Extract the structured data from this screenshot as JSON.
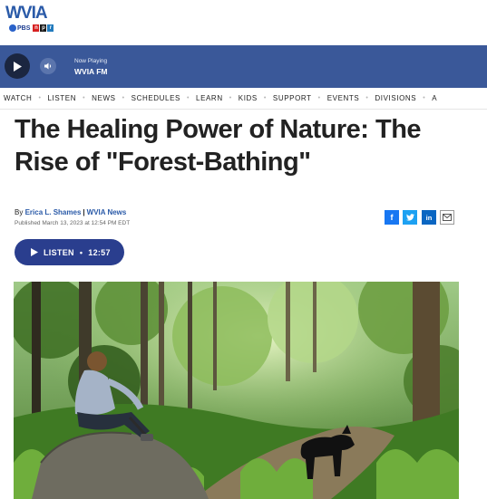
{
  "brand": {
    "logo_main": "WVIA",
    "logo_pbs": "PBS",
    "logo_npr": [
      "n",
      "p",
      "r"
    ],
    "colors": {
      "blue": "#2a5aa8",
      "grey": "#8a8d91",
      "npr_n": "#d62021",
      "npr_p": "#1a1a1a",
      "npr_r": "#237bbd"
    }
  },
  "player": {
    "now_playing_label": "Now Playing",
    "station": "WVIA FM",
    "bar_color": "#3a5899"
  },
  "nav": {
    "items": [
      "WATCH",
      "LISTEN",
      "NEWS",
      "SCHEDULES",
      "LEARN",
      "KIDS",
      "SUPPORT",
      "EVENTS",
      "DIVISIONS",
      "A"
    ]
  },
  "article": {
    "title": "The Healing Power of Nature: The Rise of \"Forest-Bathing\"",
    "by": "By",
    "author": "Erica L. Shames",
    "outlet": "WVIA News",
    "published": "Published March 13, 2023 at 12:54 PM EDT"
  },
  "share": {
    "facebook": "f",
    "twitter": "twitter-icon",
    "linkedin": "in",
    "email": "mail-icon"
  },
  "listen": {
    "label": "LISTEN",
    "dot": "•",
    "duration": "12:57",
    "color": "#2a3e8e"
  },
  "photo": {
    "subject": "forest-trail-image"
  }
}
